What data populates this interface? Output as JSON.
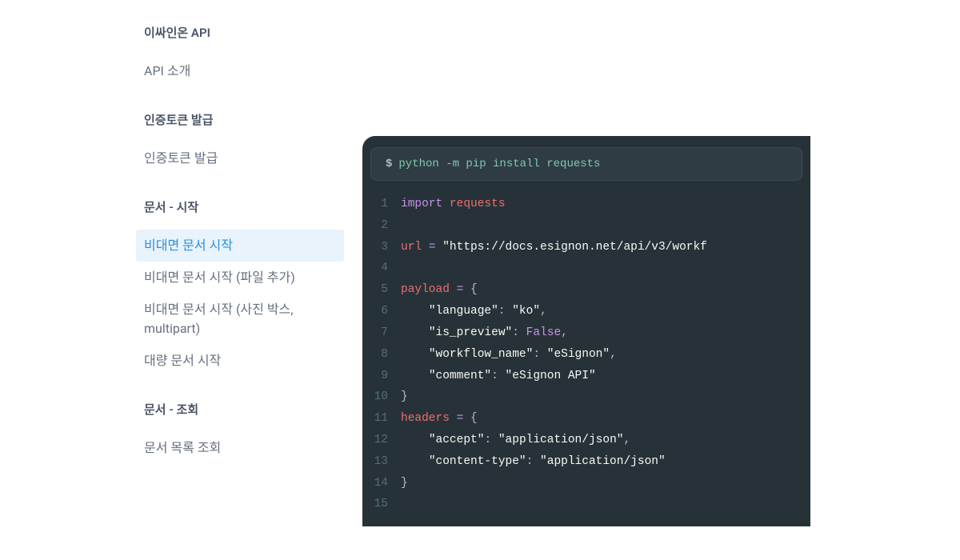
{
  "sidebar": {
    "sections": [
      {
        "title": "이싸인온 API",
        "items": [
          "API 소개"
        ]
      },
      {
        "title": "인증토큰 발급",
        "items": [
          "인증토큰 발급"
        ]
      },
      {
        "title": "문서 - 시작",
        "items": [
          "비대면 문서 시작",
          "비대면 문서 시작 (파일 추가)",
          "비대면 문서 시작 (사진 박스, multipart)",
          "대량 문서 시작"
        ],
        "active_index": 0
      },
      {
        "title": "문서 - 조회",
        "items": [
          "문서 목록 조회"
        ]
      }
    ]
  },
  "code": {
    "install_prefix": "$",
    "install_cmd": "python -m pip install requests",
    "lines": [
      {
        "n": 1,
        "tokens": [
          [
            "kw-import",
            "import "
          ],
          [
            "var",
            "requests"
          ]
        ]
      },
      {
        "n": 2,
        "tokens": []
      },
      {
        "n": 3,
        "tokens": [
          [
            "var",
            "url"
          ],
          [
            "kw-ident",
            " "
          ],
          [
            "op",
            "="
          ],
          [
            "kw-ident",
            " "
          ],
          [
            "strw",
            "\"https://docs.esignon.net/api/v3/workf"
          ]
        ]
      },
      {
        "n": 4,
        "tokens": []
      },
      {
        "n": 5,
        "tokens": [
          [
            "var",
            "payload"
          ],
          [
            "kw-ident",
            " "
          ],
          [
            "op",
            "="
          ],
          [
            "kw-ident",
            " "
          ],
          [
            "brace",
            "{"
          ]
        ]
      },
      {
        "n": 6,
        "tokens": [
          [
            "kw-ident",
            "    "
          ],
          [
            "keyw",
            "\"language\""
          ],
          [
            "punct",
            ": "
          ],
          [
            "strw",
            "\"ko\""
          ],
          [
            "punct",
            ","
          ]
        ]
      },
      {
        "n": 7,
        "tokens": [
          [
            "kw-ident",
            "    "
          ],
          [
            "keyw",
            "\"is_preview\""
          ],
          [
            "punct",
            ": "
          ],
          [
            "bool",
            "False"
          ],
          [
            "punct",
            ","
          ]
        ]
      },
      {
        "n": 8,
        "tokens": [
          [
            "kw-ident",
            "    "
          ],
          [
            "keyw",
            "\"workflow_name\""
          ],
          [
            "punct",
            ": "
          ],
          [
            "strw",
            "\"eSignon\""
          ],
          [
            "punct",
            ","
          ]
        ]
      },
      {
        "n": 9,
        "tokens": [
          [
            "kw-ident",
            "    "
          ],
          [
            "keyw",
            "\"comment\""
          ],
          [
            "punct",
            ": "
          ],
          [
            "strw",
            "\"eSignon API\""
          ]
        ]
      },
      {
        "n": 10,
        "tokens": [
          [
            "brace",
            "}"
          ]
        ]
      },
      {
        "n": 11,
        "tokens": [
          [
            "var",
            "headers"
          ],
          [
            "kw-ident",
            " "
          ],
          [
            "op",
            "="
          ],
          [
            "kw-ident",
            " "
          ],
          [
            "brace",
            "{"
          ]
        ]
      },
      {
        "n": 12,
        "tokens": [
          [
            "kw-ident",
            "    "
          ],
          [
            "keyw",
            "\"accept\""
          ],
          [
            "punct",
            ": "
          ],
          [
            "strw",
            "\"application/json\""
          ],
          [
            "punct",
            ","
          ]
        ]
      },
      {
        "n": 13,
        "tokens": [
          [
            "kw-ident",
            "    "
          ],
          [
            "keyw",
            "\"content-type\""
          ],
          [
            "punct",
            ": "
          ],
          [
            "strw",
            "\"application/json\""
          ]
        ]
      },
      {
        "n": 14,
        "tokens": [
          [
            "brace",
            "}"
          ]
        ]
      },
      {
        "n": 15,
        "tokens": []
      }
    ]
  }
}
